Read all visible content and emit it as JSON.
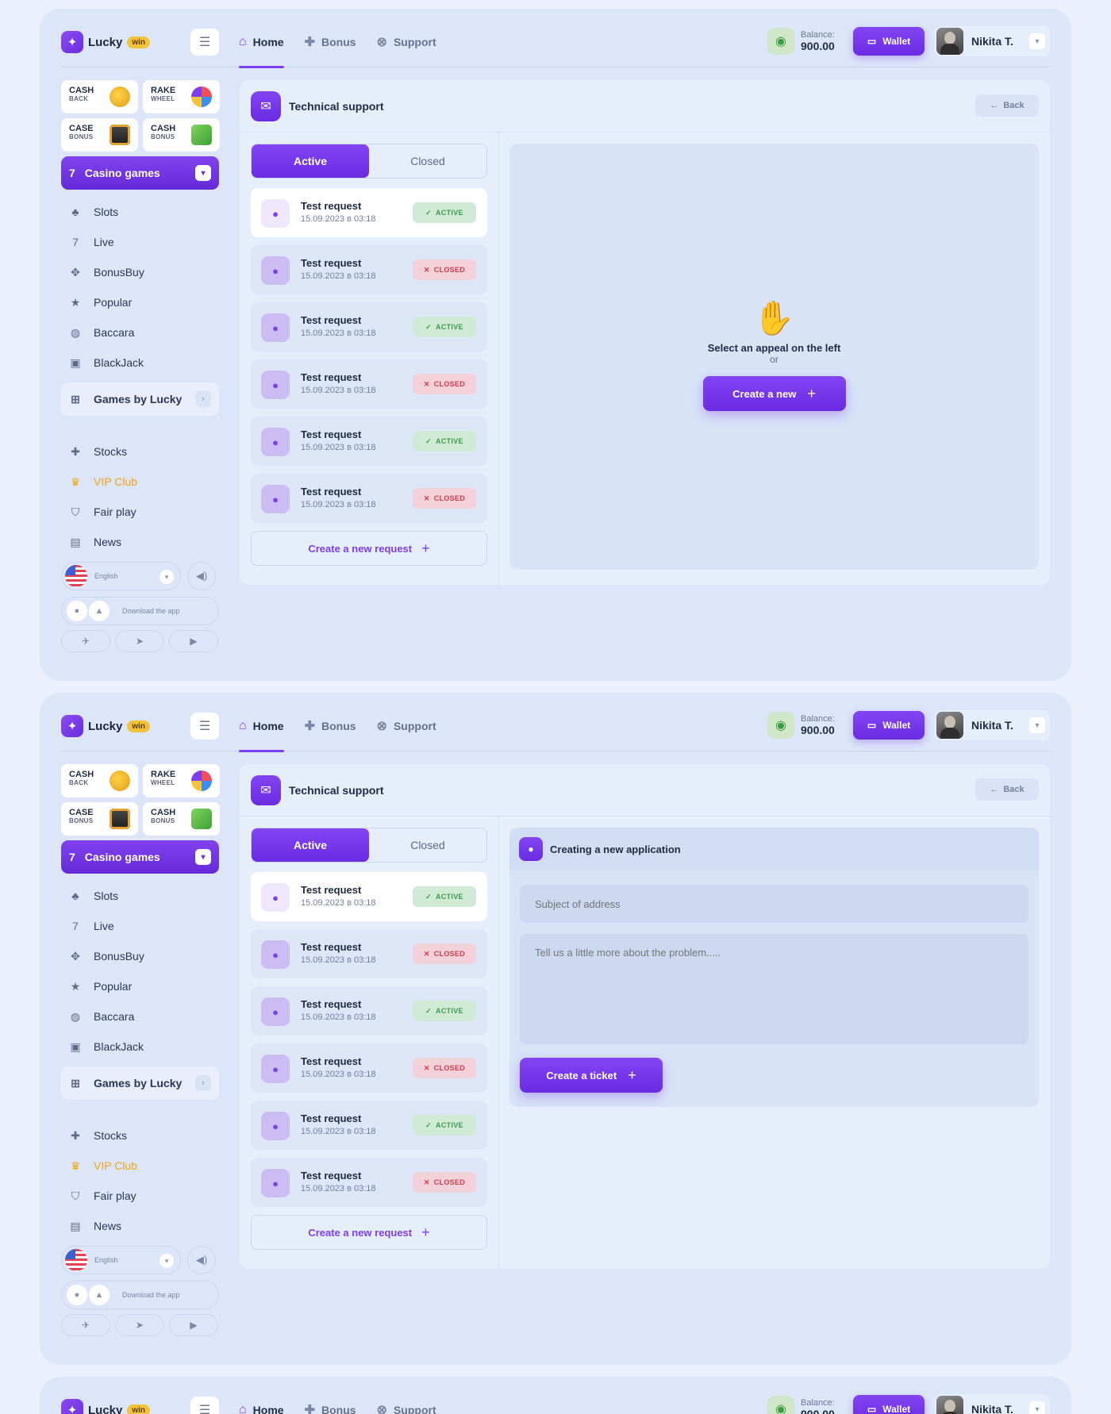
{
  "header": {
    "logo_text": "Lucky",
    "logo_badge": "win",
    "nav": [
      {
        "label": "Home",
        "icon": "home-icon"
      },
      {
        "label": "Bonus",
        "icon": "gift-icon"
      },
      {
        "label": "Support",
        "icon": "lifebuoy-icon"
      }
    ],
    "balance_label": "Balance:",
    "balance_value": "900.00",
    "wallet_label": "Wallet",
    "user_name": "Nikita T."
  },
  "sidebar": {
    "promos": [
      {
        "top": "CASH",
        "bottom": "BACK"
      },
      {
        "top": "RAKE",
        "bottom": "WHEEL"
      },
      {
        "top": "CASE",
        "bottom": "BONUS"
      },
      {
        "top": "CASH",
        "bottom": "BONUS"
      }
    ],
    "casino_label": "Casino games",
    "games": [
      {
        "label": "Slots",
        "icon": "slots-icon"
      },
      {
        "label": "Live",
        "icon": "seven-icon"
      },
      {
        "label": "BonusBuy",
        "icon": "gamepad-icon"
      },
      {
        "label": "Popular",
        "icon": "star-icon"
      },
      {
        "label": "Baccara",
        "icon": "chip-icon"
      },
      {
        "label": "BlackJack",
        "icon": "cards-icon"
      }
    ],
    "games_by_label": "Games by Lucky",
    "links": [
      {
        "label": "Stocks",
        "icon": "gift-icon"
      },
      {
        "label": "VIP Club",
        "icon": "crown-icon"
      },
      {
        "label": "Fair play",
        "icon": "shield-icon"
      },
      {
        "label": "News",
        "icon": "newspaper-icon"
      }
    ],
    "language": "English",
    "download_label": "Download the app"
  },
  "support": {
    "title": "Technical support",
    "back_label": "Back",
    "tab_active": "Active",
    "tab_closed": "Closed",
    "requests": [
      {
        "title": "Test request",
        "date": "15.09.2023 в 03:18",
        "status": "ACTIVE"
      },
      {
        "title": "Test request",
        "date": "15.09.2023 в 03:18",
        "status": "CLOSED"
      },
      {
        "title": "Test request",
        "date": "15.09.2023 в 03:18",
        "status": "ACTIVE"
      },
      {
        "title": "Test request",
        "date": "15.09.2023 в 03:18",
        "status": "CLOSED"
      },
      {
        "title": "Test request",
        "date": "15.09.2023 в 03:18",
        "status": "ACTIVE"
      },
      {
        "title": "Test request",
        "date": "15.09.2023 в 03:18",
        "status": "CLOSED"
      }
    ],
    "new_request_label": "Create a new request",
    "empty_title": "Select an appeal on the left",
    "empty_or": "or",
    "create_new_label": "Create a new",
    "form_title": "Creating a new application",
    "subject_placeholder": "Subject of address",
    "body_placeholder": "Tell us a little more about the problem.....",
    "create_ticket_label": "Create a ticket"
  },
  "colors": {
    "accent": "#7b3ff0",
    "vip": "#f0a514",
    "active_badge": "#3c9a4a",
    "closed_badge": "#d13a4a"
  }
}
